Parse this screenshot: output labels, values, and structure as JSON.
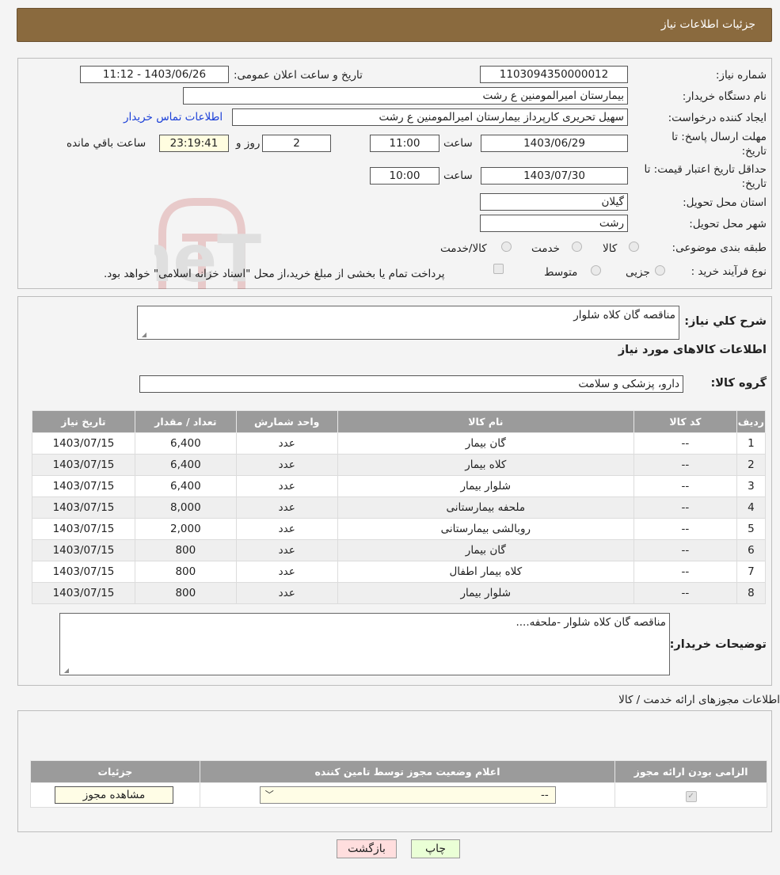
{
  "header": {
    "title": "جزئیات اطلاعات نیاز"
  },
  "info": {
    "need_number_label": "شماره نیاز:",
    "need_number": "1103094350000012",
    "announce_label": "تاریخ و ساعت اعلان عمومی:",
    "announce_value": "1403/06/26 - 11:12",
    "buyer_org_label": "نام دستگاه خریدار:",
    "buyer_org": "بیمارستان امیرالمومنین ع  رشت",
    "requester_label": "ایجاد کننده درخواست:",
    "requester": "سهیل تحریری کارپرداز بیمارستان امیرالمومنین ع  رشت",
    "contact_link": "اطلاعات تماس خریدار",
    "deadline_label_1": "مهلت ارسال پاسخ: تا",
    "deadline_label_2": "تاریخ:",
    "deadline_date": "1403/06/29",
    "time_label": "ساعت",
    "deadline_time": "11:00",
    "days_value": "2",
    "days_label": "روز و",
    "remaining_time": "23:19:41",
    "remaining_label": "ساعت باقي مانده",
    "validity_label_1": "حداقل تاریخ اعتبار قیمت: تا",
    "validity_label_2": "تاریخ:",
    "validity_date": "1403/07/30",
    "validity_time_label": "ساعت",
    "validity_time": "10:00",
    "province_label": "استان محل تحویل:",
    "province": "گیلان",
    "city_label": "شهر محل تحویل:",
    "city": "رشت",
    "category_label": "طبقه بندی موضوعی:",
    "category_options": [
      "کالا",
      "خدمت",
      "کالا/خدمت"
    ],
    "process_label": "نوع فرآیند خرید :",
    "process_options": [
      "جزیی",
      "متوسط"
    ],
    "process_note": "پرداخت تمام یا بخشی از مبلغ خرید،از محل \"اسناد خزانه اسلامی\" خواهد بود."
  },
  "details": {
    "summary_label": "شرح كلي نياز:",
    "summary_value": "مناقصه گان کلاه شلوار",
    "goods_title": "اطلاعات کالاهای مورد نیاز",
    "group_label": "گروه کالا:",
    "group_value": "دارو، پزشکی و سلامت",
    "table_headers": [
      "ردیف",
      "کد کالا",
      "نام کالا",
      "واحد شمارش",
      "تعداد / مقدار",
      "تاریخ نیاز"
    ],
    "rows": [
      [
        "1",
        "--",
        "گان بیمار",
        "عدد",
        "6,400",
        "1403/07/15"
      ],
      [
        "2",
        "--",
        "کلاه بیمار",
        "عدد",
        "6,400",
        "1403/07/15"
      ],
      [
        "3",
        "--",
        "شلوار بیمار",
        "عدد",
        "6,400",
        "1403/07/15"
      ],
      [
        "4",
        "--",
        "ملحفه بیمارستانی",
        "عدد",
        "8,000",
        "1403/07/15"
      ],
      [
        "5",
        "--",
        "روبالشی بیمارستانی",
        "عدد",
        "2,000",
        "1403/07/15"
      ],
      [
        "6",
        "--",
        "گان بیمار",
        "عدد",
        "800",
        "1403/07/15"
      ],
      [
        "7",
        "--",
        "کلاه بیمار اطفال",
        "عدد",
        "800",
        "1403/07/15"
      ],
      [
        "8",
        "--",
        "شلوار بیمار",
        "عدد",
        "800",
        "1403/07/15"
      ]
    ],
    "buyer_notes_label": "توضیحات خریدار:",
    "buyer_notes_value": "مناقصه گان کلاه شلوار -ملحفه...."
  },
  "permits": {
    "section_title": "اطلاعات مجوزهای ارائه خدمت / کالا",
    "headers": [
      "الزامی بودن ارائه مجوز",
      "اعلام وضعیت مجوز توسط تامین کننده",
      "جزئیات"
    ],
    "select_value": "--",
    "view_button": "مشاهده مجوز"
  },
  "actions": {
    "print": "چاپ",
    "back": "بازگشت"
  },
  "watermark": {
    "text": "AriaTender.neT"
  }
}
